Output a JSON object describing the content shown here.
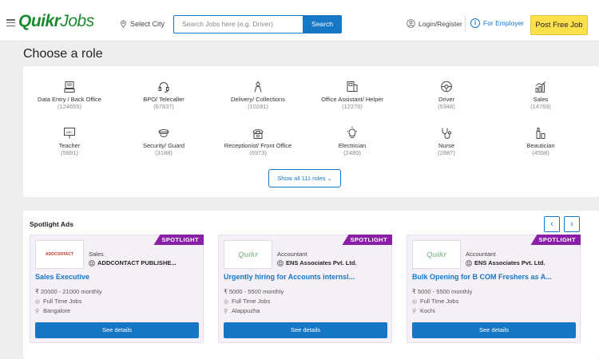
{
  "header": {
    "logo_bold": "Quikr",
    "logo_rest": "Jobs",
    "city_label": "Select City",
    "search_placeholder": "Search Jobs here (e.g. Driver)",
    "search_button": "Search",
    "login_label": "Login/Register",
    "employer_label": "For Employer",
    "post_button": "Post Free Job"
  },
  "roles_section": {
    "title": "Choose a role",
    "show_all": "Show all 111 roles",
    "roles": [
      {
        "name": "Data Entry / Back Office",
        "count": "(124655)",
        "icon": "computer-icon"
      },
      {
        "name": "BPO/ Telecaller",
        "count": "(67837)",
        "icon": "headset-icon"
      },
      {
        "name": "Delivery/ Collections",
        "count": "(10281)",
        "icon": "delivery-icon"
      },
      {
        "name": "Office Assistant/ Helper",
        "count": "(12270)",
        "icon": "office-icon"
      },
      {
        "name": "Driver",
        "count": "(5348)",
        "icon": "steering-wheel-icon"
      },
      {
        "name": "Sales",
        "count": "(14769)",
        "icon": "sales-chart-icon"
      },
      {
        "name": "Teacher",
        "count": "(5891)",
        "icon": "blackboard-icon"
      },
      {
        "name": "Security/ Guard",
        "count": "(3188)",
        "icon": "guard-cap-icon"
      },
      {
        "name": "Receptionist/ Front Office",
        "count": "(6973)",
        "icon": "telephone-icon"
      },
      {
        "name": "Electrician",
        "count": "(2480)",
        "icon": "bulb-icon"
      },
      {
        "name": "Nurse",
        "count": "(2887)",
        "icon": "stethoscope-icon"
      },
      {
        "name": "Beautician",
        "count": "(4558)",
        "icon": "beauty-icon"
      }
    ]
  },
  "spotlight": {
    "title": "Spotlight Ads",
    "tag": "SPOTLIGHT",
    "ads": [
      {
        "logo": "ADDCONTACT",
        "category": "Sales",
        "company": "ADDCONTACT PUBLISHE...",
        "title": "Sales Executive",
        "salary": "₹ 20000 - 21000 monthly",
        "type": "Full Time Jobs",
        "location": "Bangalore",
        "button": "See details"
      },
      {
        "logo": "Quikr",
        "category": "Accountant",
        "company": "ENS Associates Pvt. Ltd.",
        "title": "Urgently hiring for Accounts internsl...",
        "salary": "₹ 5000 - 5500 monthly",
        "type": "Full Time Jobs",
        "location": "Alappuzha",
        "button": "See details"
      },
      {
        "logo": "Quikr",
        "category": "Accountant",
        "company": "ENS Associates Pvt. Ltd.",
        "title": "Bulk Opening for B COM Freshers as A...",
        "salary": "₹ 5000 - 5500 monthly",
        "type": "Full Time Jobs",
        "location": "Kochi",
        "button": "See details"
      }
    ]
  }
}
